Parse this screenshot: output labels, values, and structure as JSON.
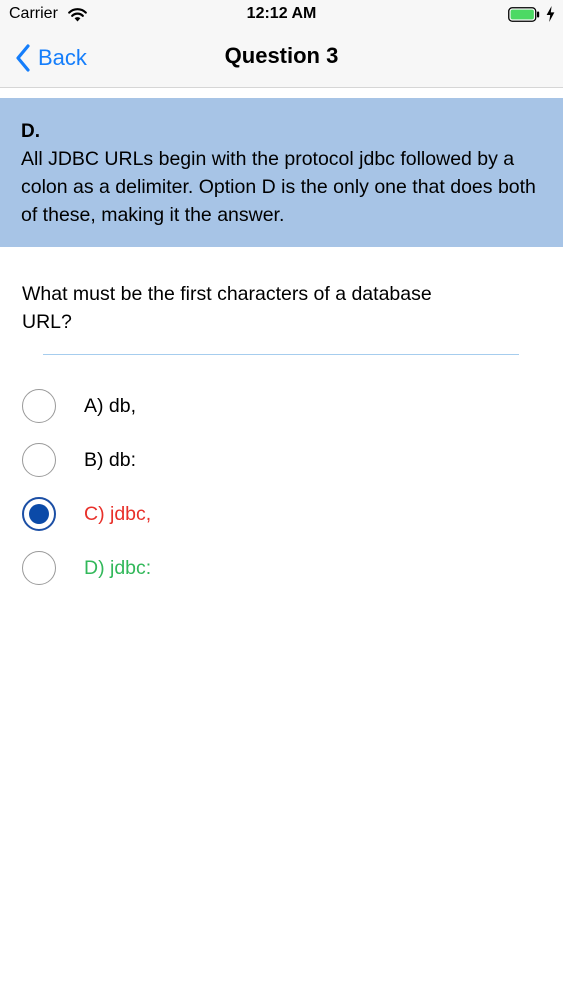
{
  "status_bar": {
    "carrier": "Carrier",
    "time": "12:12 AM"
  },
  "nav": {
    "back_label": "Back",
    "title": "Question 3"
  },
  "explanation": {
    "answer": "D.",
    "text": "All JDBC URLs begin with the protocol jdbc followed by a colon as a delimiter. Option D is the only one that does both of these, making it the answer."
  },
  "question": {
    "text": "What must be the first characters of a database URL?"
  },
  "options": [
    {
      "label": "A) db,",
      "selected": false,
      "color": "#000000"
    },
    {
      "label": "B) db:",
      "selected": false,
      "color": "#000000"
    },
    {
      "label": "C) jdbc,",
      "selected": true,
      "color": "#e8302a"
    },
    {
      "label": "D) jdbc:",
      "selected": false,
      "color": "#32b85a"
    }
  ],
  "colors": {
    "accent": "#157efb",
    "explanation_bg": "#a7c4e6",
    "battery": "#4cd964",
    "radio_selected": "#0b4aa8"
  }
}
